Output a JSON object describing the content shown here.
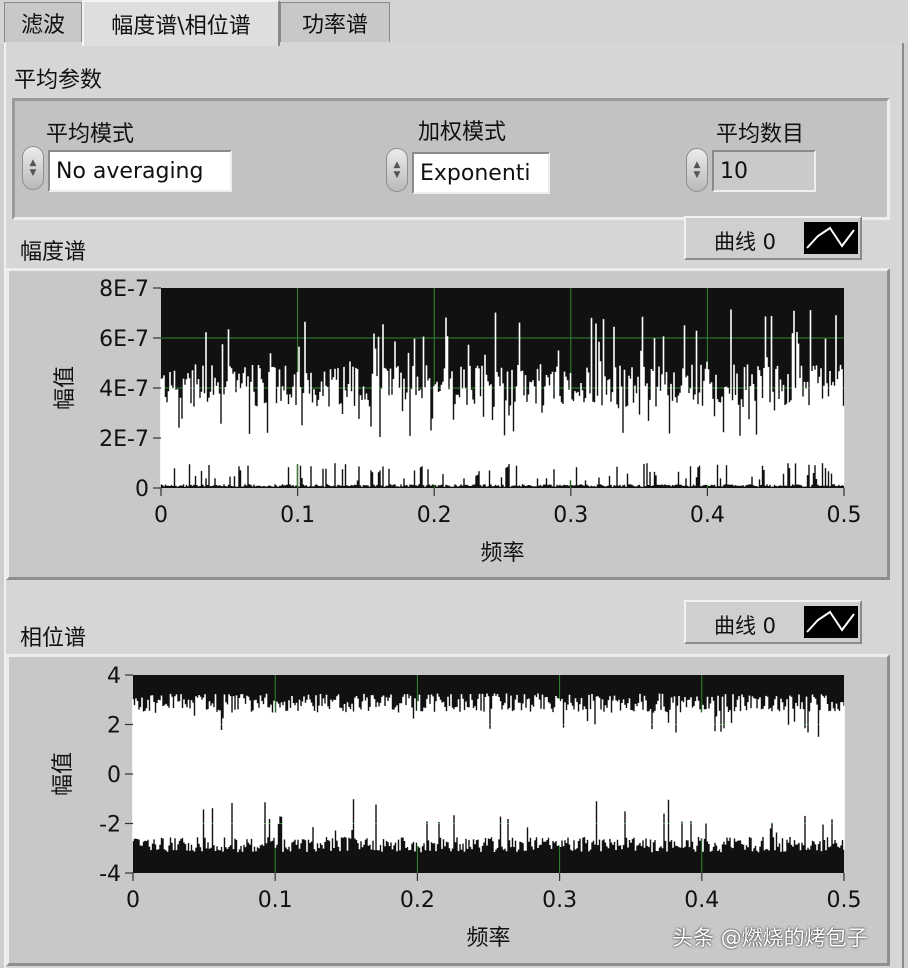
{
  "tabs": [
    {
      "label": "滤波"
    },
    {
      "label": "幅度谱\\相位谱"
    },
    {
      "label": "功率谱"
    }
  ],
  "averaging": {
    "section_title": "平均参数",
    "mode_label": "平均模式",
    "mode_value": "No averaging",
    "weight_label": "加权模式",
    "weight_value": "Exponenti",
    "count_label": "平均数目",
    "count_value": "10"
  },
  "amplitude_graph": {
    "title": "幅度谱",
    "legend_label": "曲线 0",
    "ylabel": "幅值",
    "xlabel": "频率",
    "yticks": [
      "8E-7",
      "6E-7",
      "4E-7",
      "2E-7",
      "0"
    ],
    "xticks": [
      "0",
      "0.1",
      "0.2",
      "0.3",
      "0.4",
      "0.5"
    ]
  },
  "phase_graph": {
    "title": "相位谱",
    "legend_label": "曲线 0",
    "ylabel": "幅值",
    "xlabel": "频率",
    "yticks": [
      "4",
      "2",
      "0",
      "-2",
      "-4"
    ],
    "xticks": [
      "0",
      "0.1",
      "0.2",
      "0.3",
      "0.4",
      "0.5"
    ]
  },
  "watermark": "头条 @燃烧的烤包子",
  "colors": {
    "plot_background": "#111111",
    "grid": "#2f8a2f",
    "trace": "#ffffff"
  },
  "chart_data": [
    {
      "type": "line",
      "title": "幅度谱",
      "xlabel": "频率",
      "ylabel": "幅值",
      "xlim": [
        0,
        0.5
      ],
      "ylim": [
        0,
        8e-07
      ],
      "series": [
        {
          "name": "曲线 0",
          "description_envelope": {
            "upper_typical": 4.5e-07,
            "upper_peaks": 7.2e-07,
            "lower_typical": 1e-08,
            "lower_peaks": 1e-07
          }
        }
      ]
    },
    {
      "type": "line",
      "title": "相位谱",
      "xlabel": "频率",
      "ylabel": "幅值",
      "xlim": [
        0,
        0.5
      ],
      "ylim": [
        -4,
        4
      ],
      "series": [
        {
          "name": "曲线 0",
          "description_envelope": {
            "upper_typical": 3.1,
            "upper_min": 1.5,
            "lower_typical": -3.1,
            "lower_max": -1.0
          }
        }
      ]
    }
  ]
}
